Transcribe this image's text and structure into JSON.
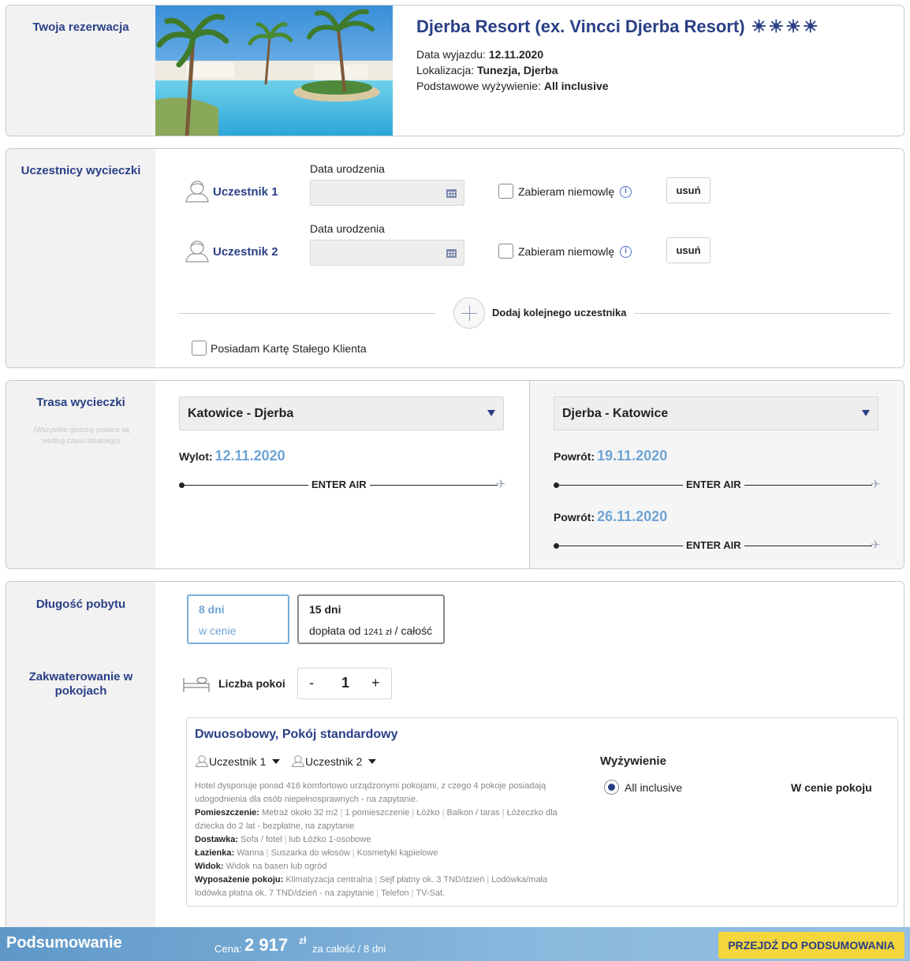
{
  "reservation": {
    "section_title": "Twoja rezerwacja",
    "hotel_name": "Djerba Resort (ex. Vincci Djerba Resort)",
    "stars": [
      "sun-icon",
      "sun-icon",
      "sun-icon",
      "sun-icon"
    ],
    "departure_label": "Data wyjazdu:",
    "departure_value": "12.11.2020",
    "location_label": "Lokalizacja:",
    "location_value": "Tunezja, Djerba",
    "board_label": "Podstawowe wyżywienie:",
    "board_value": "All inclusive"
  },
  "participants": {
    "section_title": "Uczestnicy wycieczki",
    "items": [
      {
        "label": "Uczestnik 1",
        "dob_label": "Data urodzenia",
        "dob_value": "",
        "infant_label": "Zabieram niemowlę",
        "remove_label": "usuń"
      },
      {
        "label": "Uczestnik 2",
        "dob_label": "Data urodzenia",
        "dob_value": "",
        "infant_label": "Zabieram niemowlę",
        "remove_label": "usuń"
      }
    ],
    "add_label": "Dodaj kolejnego uczestnika",
    "loyalty_label": "Posiadam Kartę Stałego Klienta"
  },
  "route": {
    "section_title": "Trasa wycieczki",
    "section_note": "(Wszystkie godziny podane są według czasu lokalnego)",
    "outbound": {
      "select": "Katowice - Djerba",
      "label": "Wylot:",
      "date": "12.11.2020",
      "airline": "ENTER AIR"
    },
    "return": {
      "select": "Djerba - Katowice",
      "flights": [
        {
          "label": "Powrót:",
          "date": "19.11.2020",
          "airline": "ENTER AIR"
        },
        {
          "label": "Powrót:",
          "date": "26.11.2020",
          "airline": "ENTER AIR"
        }
      ]
    }
  },
  "stay": {
    "section_title": "Długość pobytu",
    "options": [
      {
        "days": "8 dni",
        "sub": "w cenie",
        "selected": true
      },
      {
        "days": "15 dni",
        "sub_prefix": "dopłata od",
        "sub_amount": "1241 zł",
        "sub_suffix": "/ całość",
        "selected": false
      }
    ]
  },
  "rooms": {
    "section_title": "Zakwaterowanie w pokojach",
    "count_label": "Liczba pokoi",
    "minus": "-",
    "count": "1",
    "plus": "+",
    "room": {
      "title": "Dwuosobowy, Pokój standardowy",
      "occupants": [
        "Uczestnik 1",
        "Uczestnik 2"
      ],
      "intro": "Hotel dysponuje ponad 416 komfortowo urządzonymi pokojami, z czego 4 pokoje posiadają udogodnienia dla osób niepełnosprawnych - na zapytanie.",
      "details": [
        {
          "label": "Pomieszczenie:",
          "items": [
            "Metraż około 32 m2",
            "1 pomieszczenie",
            "Łóżko",
            "Balkon / taras",
            "Łóżeczko dla dziecka do 2 lat - bezpłatne, na zapytanie"
          ]
        },
        {
          "label": "Dostawka:",
          "items": [
            "Sofa / fotel",
            "lub Łóżko 1-osobowe"
          ]
        },
        {
          "label": "Łazienka:",
          "items": [
            "Wanna",
            "Suszarka do włosów",
            "Kosmetyki kąpielowe"
          ]
        },
        {
          "label": "Widok:",
          "items": [
            "Widok na basen lub ogród"
          ]
        },
        {
          "label": "Wyposażenie pokoju:",
          "items": [
            "Klimatyzacja centralna",
            "Sejf płatny ok. 3 TND/dzień",
            "Lodówka/mała lodówka płatna ok. 7 TND/dzień - na zapytanie",
            "Telefon",
            "TV-Sat."
          ]
        }
      ],
      "board_title": "Wyżywienie",
      "board_option": "All inclusive",
      "board_price": "W cenie pokoju"
    }
  },
  "summary": {
    "title": "Podsumowanie",
    "price_label": "Cena:",
    "price_value": "2 917",
    "currency": "zł",
    "price_note": "za całość / 8 dni",
    "cta": "PRZEJDŹ DO PODSUMOWANIA"
  },
  "colors": {
    "primary": "#2a3f86",
    "date_blue": "#6fa4d6",
    "cta_yellow": "#f3d63b",
    "summary_bar": "#6fa4d3"
  }
}
